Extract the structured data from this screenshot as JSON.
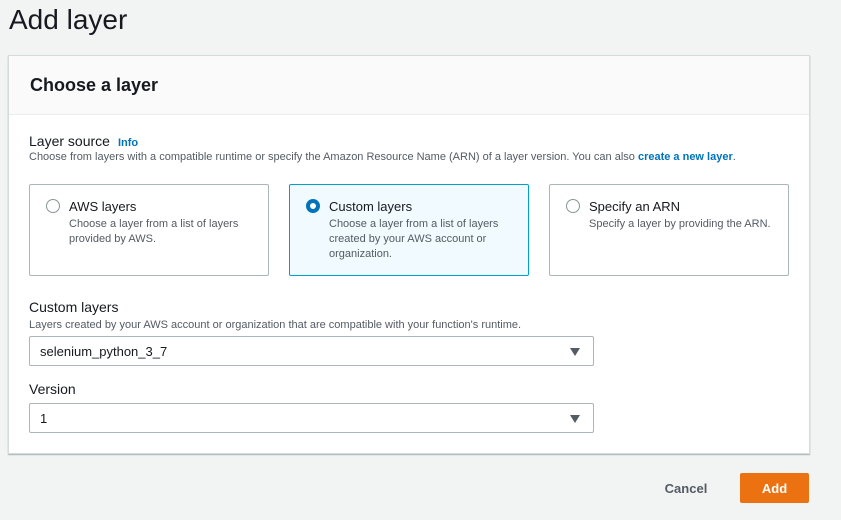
{
  "page": {
    "title": "Add layer"
  },
  "panel": {
    "title": "Choose a layer"
  },
  "layer_source": {
    "label": "Layer source",
    "info": "Info",
    "description": "Choose from layers with a compatible runtime or specify the Amazon Resource Name (ARN) of a layer version. You can also ",
    "link": "create a new layer",
    "description_end": ".",
    "options": [
      {
        "title": "AWS layers",
        "desc": "Choose a layer from a list of layers provided by AWS.",
        "selected": false
      },
      {
        "title": "Custom layers",
        "desc": "Choose a layer from a list of layers created by your AWS account or organization.",
        "selected": true
      },
      {
        "title": "Specify an ARN",
        "desc": "Specify a layer by providing the ARN.",
        "selected": false
      }
    ]
  },
  "custom_layers": {
    "label": "Custom layers",
    "description": "Layers created by your AWS account or organization that are compatible with your function's runtime.",
    "value": "selenium_python_3_7"
  },
  "version": {
    "label": "Version",
    "value": "1"
  },
  "actions": {
    "cancel": "Cancel",
    "add": "Add"
  },
  "colors": {
    "primary": "#ec7211",
    "link": "#0073bb",
    "selected_border": "#00a1c9",
    "selected_bg": "#f1faff"
  },
  "icons": {
    "dropdown": "caret-down-icon",
    "radio": "radio-icon"
  }
}
